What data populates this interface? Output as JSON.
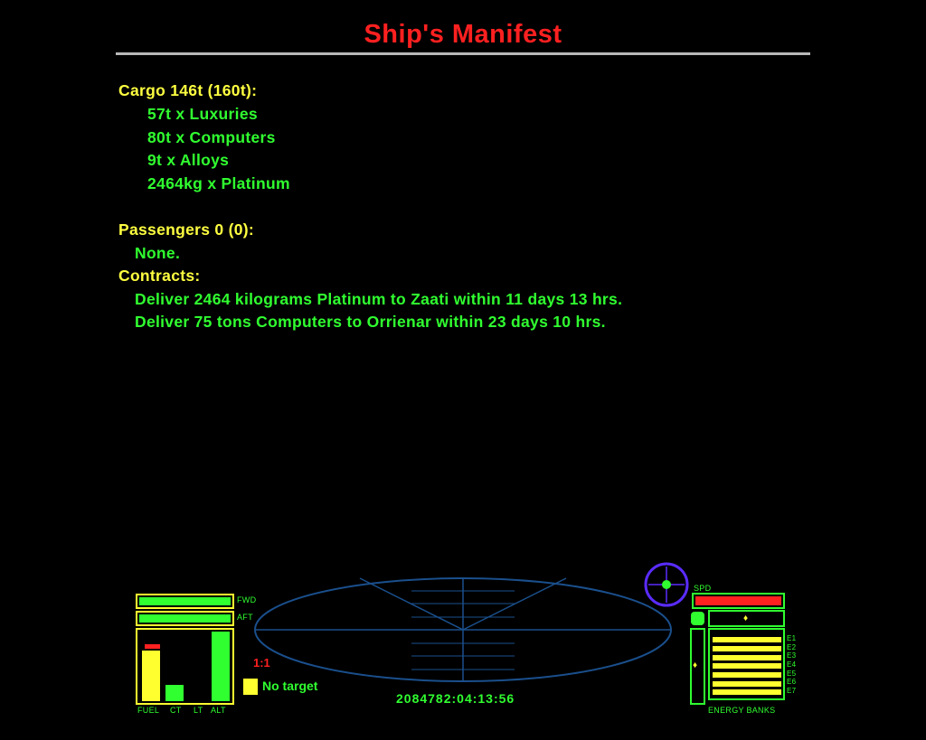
{
  "screen": {
    "title": "Ship's Manifest"
  },
  "cargo": {
    "header": "Cargo 146t (160t):",
    "items": [
      "57t x Luxuries",
      "80t x Computers",
      "9t x Alloys",
      "2464kg x Platinum"
    ]
  },
  "passengers": {
    "header": "Passengers 0 (0):",
    "items": [
      "None."
    ]
  },
  "contracts": {
    "header": "Contracts:",
    "items": [
      "Deliver 2464 kilograms Platinum to Zaati within 11 days 13 hrs.",
      "Deliver 75 tons Computers to Orrienar within 23 days 10 hrs."
    ]
  },
  "hud": {
    "shield_fwd_label": "FWD",
    "shield_aft_label": "AFT",
    "gauge_labels": [
      "FUEL",
      "CT",
      "LT",
      "ALT"
    ],
    "gauge_levels": {
      "FUEL": 0.72,
      "CT": 0.23,
      "LT": 0.0,
      "ALT": 1.0
    },
    "fuel_marker_color": "#ff2020",
    "zoom": "1:1",
    "target_text": "No target",
    "clock": "2084782:04:13:56",
    "speed_label": "SPD",
    "speed_level": 1.0,
    "energy_labels": [
      "E1",
      "E2",
      "E3",
      "E4",
      "E5",
      "E6",
      "E7"
    ],
    "energy_levels": [
      1,
      1,
      1,
      1,
      1,
      1,
      1
    ],
    "energy_banks_label": "ENERGY BANKS",
    "colors": {
      "hud_green": "#30ff30",
      "hud_yellow": "#ffff30",
      "hud_red": "#ff2020",
      "scanner_blue": "#1a4f8c",
      "compass_purple": "#5a2cff"
    }
  }
}
